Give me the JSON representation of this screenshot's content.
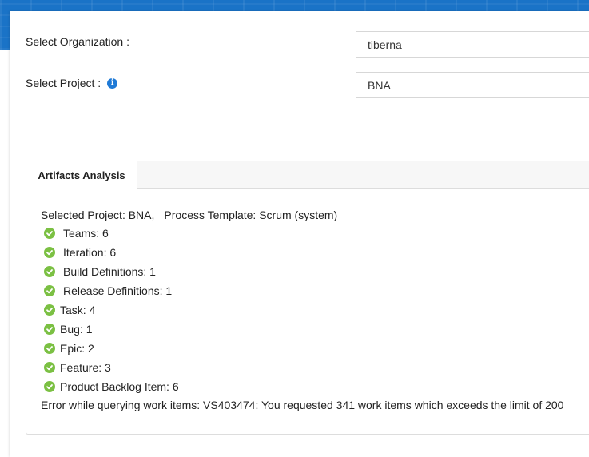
{
  "organization": {
    "label": "Select Organization :",
    "value": "tiberna"
  },
  "project": {
    "label": "Select Project :",
    "value": "BNA"
  },
  "panel": {
    "tab_label": "Artifacts Analysis",
    "summary": {
      "project": "Selected Project: BNA,",
      "template": "Process Template: Scrum (system)"
    },
    "items": [
      {
        "label": "Teams: 6"
      },
      {
        "label": "Iteration: 6"
      },
      {
        "label": "Build Definitions: 1"
      },
      {
        "label": "Release Definitions: 1"
      },
      {
        "label": "Task: 4"
      },
      {
        "label": "Bug: 1"
      },
      {
        "label": "Epic: 2"
      },
      {
        "label": "Feature: 3"
      },
      {
        "label": "Product Backlog Item: 6"
      }
    ],
    "error": "Error while querying work items: VS403474: You requested 341 work items which exceeds the limit of 200"
  },
  "colors": {
    "banner": "#1a73c7",
    "check": "#7bc043",
    "info": "#1f7ad6"
  }
}
